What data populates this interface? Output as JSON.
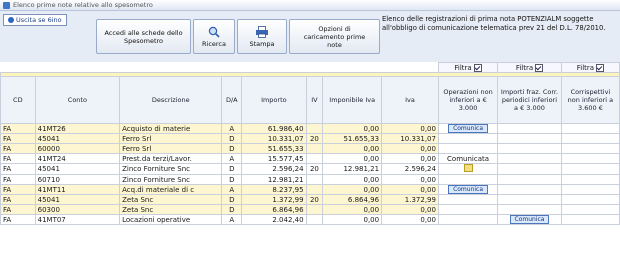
{
  "window": {
    "title": "Elenco prime note relative allo spesometro"
  },
  "toolbar": {
    "exit_label": "Uscita se 6ino",
    "btn_schede": "Accedi alle schede dello Spesometro",
    "btn_ricerca": "Ricerca",
    "btn_stampa": "Stampa",
    "btn_opzioni": "Opzioni di caricamento prime note"
  },
  "info_text": "Elenco delle registrazioni di prima nota POTENZIALM soggette all'obbligo di comunicazione telematica prev 21 del D.L. 78/2010.",
  "filter": {
    "label": "Filtra"
  },
  "columns": {
    "cd": "CD",
    "conto": "Conto",
    "descrizione": "Descrizione",
    "da": "D/A",
    "importo": "Importo",
    "iv": "IV",
    "imponibile": "Imponibile Iva",
    "iva": "Iva",
    "op_non_inferiori": "Operazioni non inferiori a € 3.000",
    "importi_fraz": "Importi fraz. Corr. periodici inferiori a € 3.000",
    "corrispettivi": "Corrispettivi non inferiori a 3.600 €"
  },
  "labels": {
    "comunica": "Comunica",
    "comunicata": "Comunicata"
  },
  "rows": [
    {
      "group": "yellow",
      "cd": "FA",
      "conto": "41MT26",
      "descrizione": "Acquisto di materie",
      "da": "A",
      "importo": "61.986,40",
      "iv": "",
      "imponibile": "0,00",
      "iva": "0,00",
      "flag": "comunica_op"
    },
    {
      "group": "yellow",
      "cd": "FA",
      "conto": "45041",
      "descrizione": "Ferro Srl",
      "da": "D",
      "importo": "10.331,07",
      "iv": "20",
      "imponibile": "51.655,33",
      "iva": "10.331,07",
      "flag": ""
    },
    {
      "group": "yellow",
      "cd": "FA",
      "conto": "60000",
      "descrizione": "Ferro Srl",
      "da": "D",
      "importo": "51.655,33",
      "iv": "",
      "imponibile": "0,00",
      "iva": "0,00",
      "flag": ""
    },
    {
      "group": "white",
      "cd": "FA",
      "conto": "41MT24",
      "descrizione": "Prest.da terzi/Lavor.",
      "da": "A",
      "importo": "15.577,45",
      "iv": "",
      "imponibile": "0,00",
      "iva": "0,00",
      "flag": "comunicata"
    },
    {
      "group": "white",
      "cd": "FA",
      "conto": "45041",
      "descrizione": "Zinco Forniture Snc",
      "da": "D",
      "importo": "2.596,24",
      "iv": "20",
      "imponibile": "12.981,21",
      "iva": "2.596,24",
      "flag": "note"
    },
    {
      "group": "white",
      "cd": "FA",
      "conto": "60710",
      "descrizione": "Zinco Forniture Snc",
      "da": "D",
      "importo": "12.981,21",
      "iv": "",
      "imponibile": "0,00",
      "iva": "0,00",
      "flag": ""
    },
    {
      "group": "yellow",
      "cd": "FA",
      "conto": "41MT11",
      "descrizione": "Acq.di materiale di c",
      "da": "A",
      "importo": "8.237,95",
      "iv": "",
      "imponibile": "0,00",
      "iva": "0,00",
      "flag": "comunica_op"
    },
    {
      "group": "yellow",
      "cd": "FA",
      "conto": "45041",
      "descrizione": "Zeta Snc",
      "da": "D",
      "importo": "1.372,99",
      "iv": "20",
      "imponibile": "6.864,96",
      "iva": "1.372,99",
      "flag": ""
    },
    {
      "group": "yellow",
      "cd": "FA",
      "conto": "60300",
      "descrizione": "Zeta Snc",
      "da": "D",
      "importo": "6.864,96",
      "iv": "",
      "imponibile": "0,00",
      "iva": "0,00",
      "flag": ""
    },
    {
      "group": "white",
      "cd": "FA",
      "conto": "41MT07",
      "descrizione": "Locazioni operative",
      "da": "A",
      "importo": "2.042,40",
      "iv": "",
      "imponibile": "0,00",
      "iva": "0,00",
      "flag": "comunica_fraz"
    }
  ]
}
